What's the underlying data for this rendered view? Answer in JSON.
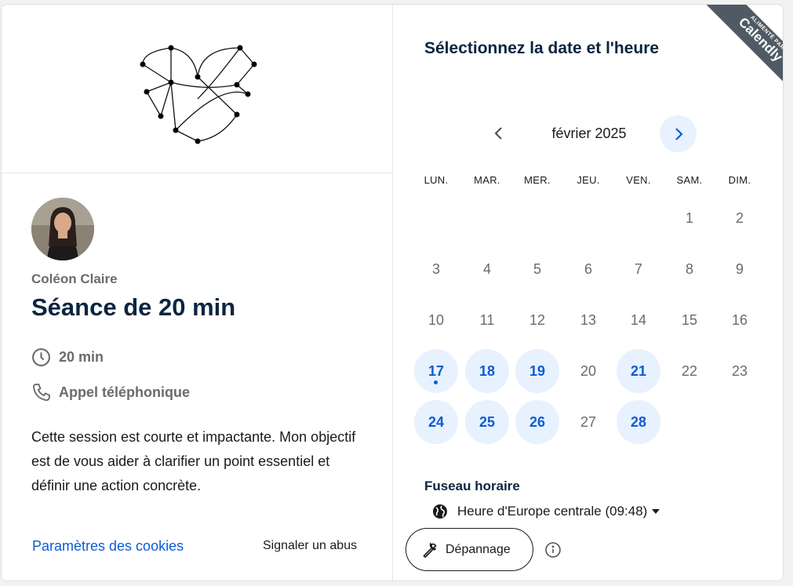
{
  "host": {
    "name": "Coléon Claire"
  },
  "event": {
    "title": "Séance de 20 min",
    "duration": "20 min",
    "location": "Appel téléphonique",
    "description": "Cette session est courte et impactante. Mon objectif est de vous aider à clarifier un point essentiel et définir une action concrète."
  },
  "footer": {
    "cookies": "Paramètres des cookies",
    "report": "Signaler un abus"
  },
  "calendar": {
    "title": "Sélectionnez la date et l'heure",
    "month": "février 2025",
    "weekdays": [
      "LUN.",
      "MAR.",
      "MER.",
      "JEU.",
      "VEN.",
      "SAM.",
      "DIM."
    ],
    "weeks": [
      [
        null,
        null,
        null,
        null,
        null,
        "1",
        "2"
      ],
      [
        "3",
        "4",
        "5",
        "6",
        "7",
        "8",
        "9"
      ],
      [
        "10",
        "11",
        "12",
        "13",
        "14",
        "15",
        "16"
      ],
      [
        "17",
        "18",
        "19",
        "20",
        "21",
        "22",
        "23"
      ],
      [
        "24",
        "25",
        "26",
        "27",
        "28",
        null,
        null
      ]
    ],
    "available": [
      "17",
      "18",
      "19",
      "21",
      "24",
      "25",
      "26",
      "28"
    ],
    "today": "17"
  },
  "timezone": {
    "title": "Fuseau horaire",
    "value": "Heure d'Europe centrale (09:48)"
  },
  "buttons": {
    "troubleshoot": "Dépannage"
  },
  "badge": {
    "powered": "ALIMENTÉ PAR",
    "brand": "Calendly"
  },
  "colors": {
    "accent": "#0b5cd6",
    "available_bg": "#e8f1fe",
    "title": "#0a2540",
    "ribbon": "#4f5a64"
  }
}
